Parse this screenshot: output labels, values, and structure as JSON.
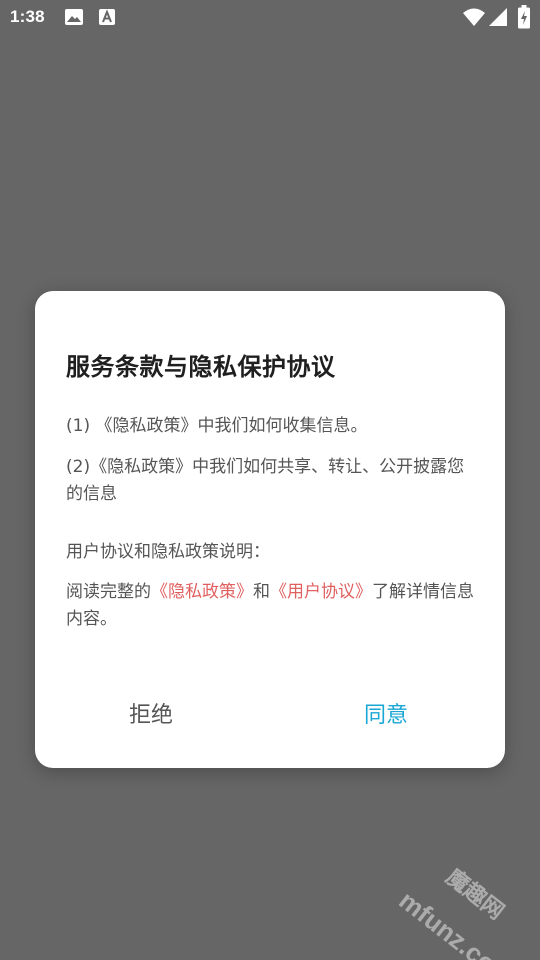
{
  "status_bar": {
    "time": "1:38",
    "icons": [
      "gallery-icon",
      "a-icon",
      "wifi-icon",
      "signal-icon",
      "battery-icon"
    ]
  },
  "dialog": {
    "title": "服务条款与隐私保护协议",
    "item1": "(1) 《隐私政策》中我们如何收集信息。",
    "item2": "(2)《隐私政策》中我们如何共享、转让、公开披露您的信息",
    "section_heading": "用户协议和隐私政策说明：",
    "read_prefix": "阅读完整的",
    "privacy_link": "《隐私政策》",
    "and_text": "和",
    "user_link": "《用户协议》",
    "read_suffix": "了解详情信息内容。",
    "reject_label": "拒绝",
    "agree_label": "同意"
  },
  "colors": {
    "overlay": "#666666",
    "link": "#e06060",
    "agree": "#1aa7d6",
    "text": "#555555"
  },
  "watermark": {
    "text_en": "mfunz.com",
    "text_cn": "魔趣网"
  }
}
